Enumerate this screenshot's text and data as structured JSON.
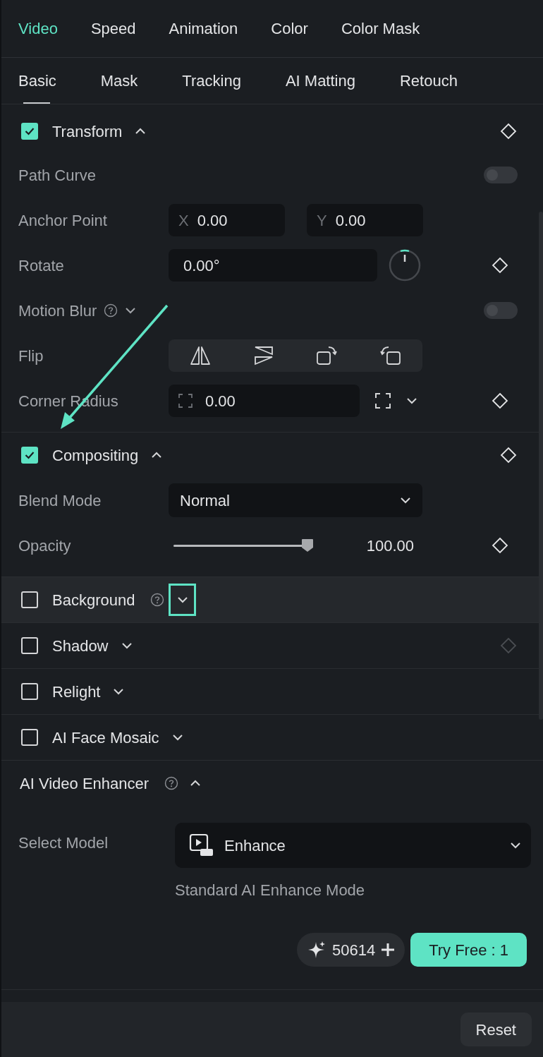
{
  "main_tabs": [
    {
      "label": "Video",
      "selected": true
    },
    {
      "label": "Speed",
      "selected": false
    },
    {
      "label": "Animation",
      "selected": false
    },
    {
      "label": "Color",
      "selected": false
    },
    {
      "label": "Color Mask",
      "selected": false
    }
  ],
  "sub_tabs": [
    {
      "label": "Basic",
      "selected": true
    },
    {
      "label": "Mask",
      "selected": false
    },
    {
      "label": "Tracking",
      "selected": false
    },
    {
      "label": "AI Matting",
      "selected": false
    },
    {
      "label": "Retouch",
      "selected": false
    }
  ],
  "sections": [
    {
      "kind": "check",
      "title": "Transform",
      "checked": true,
      "expanded": true,
      "keyframe": true,
      "rows": [
        {
          "kind": "toggle",
          "label": "Path Curve",
          "on": false
        },
        {
          "kind": "xy",
          "label": "Anchor Point",
          "fields": [
            {
              "prefix": "X",
              "value": "0.00"
            },
            {
              "prefix": "Y",
              "value": "0.00"
            }
          ]
        },
        {
          "kind": "rotate",
          "label": "Rotate",
          "value": "0.00°",
          "keyframe": true
        },
        {
          "kind": "toggle",
          "label": "Motion Blur",
          "on": false,
          "help": true,
          "expanded": false
        },
        {
          "kind": "flip",
          "label": "Flip"
        },
        {
          "kind": "radius",
          "label": "Corner Radius",
          "value": "0.00",
          "keyframe": true
        }
      ]
    },
    {
      "kind": "check",
      "title": "Compositing",
      "checked": true,
      "expanded": true,
      "keyframe": true,
      "rows": [
        {
          "kind": "select",
          "label": "Blend Mode",
          "value": "Normal"
        },
        {
          "kind": "slider",
          "label": "Opacity",
          "level": 1,
          "reading": "100.00",
          "keyframe": true
        }
      ]
    },
    {
      "kind": "check",
      "title": "Background",
      "checked": false,
      "expanded": false,
      "help": true,
      "highlighted": true
    },
    {
      "kind": "check",
      "title": "Shadow",
      "checked": false,
      "expanded": false,
      "keyframe": true,
      "disabled": true
    },
    {
      "kind": "check",
      "title": "Relight",
      "checked": false,
      "expanded": false
    },
    {
      "kind": "check",
      "title": "AI Face Mosaic",
      "checked": false,
      "expanded": false
    },
    {
      "kind": "enhancer",
      "title": "AI Video Enhancer",
      "help": true,
      "expanded": true,
      "model_label": "Select Model",
      "model": "Enhance",
      "hint": "Standard AI Enhance Mode",
      "credits": "50614",
      "try_button": "Try Free : 1"
    }
  ],
  "footer": {
    "reset_button": "Reset"
  }
}
